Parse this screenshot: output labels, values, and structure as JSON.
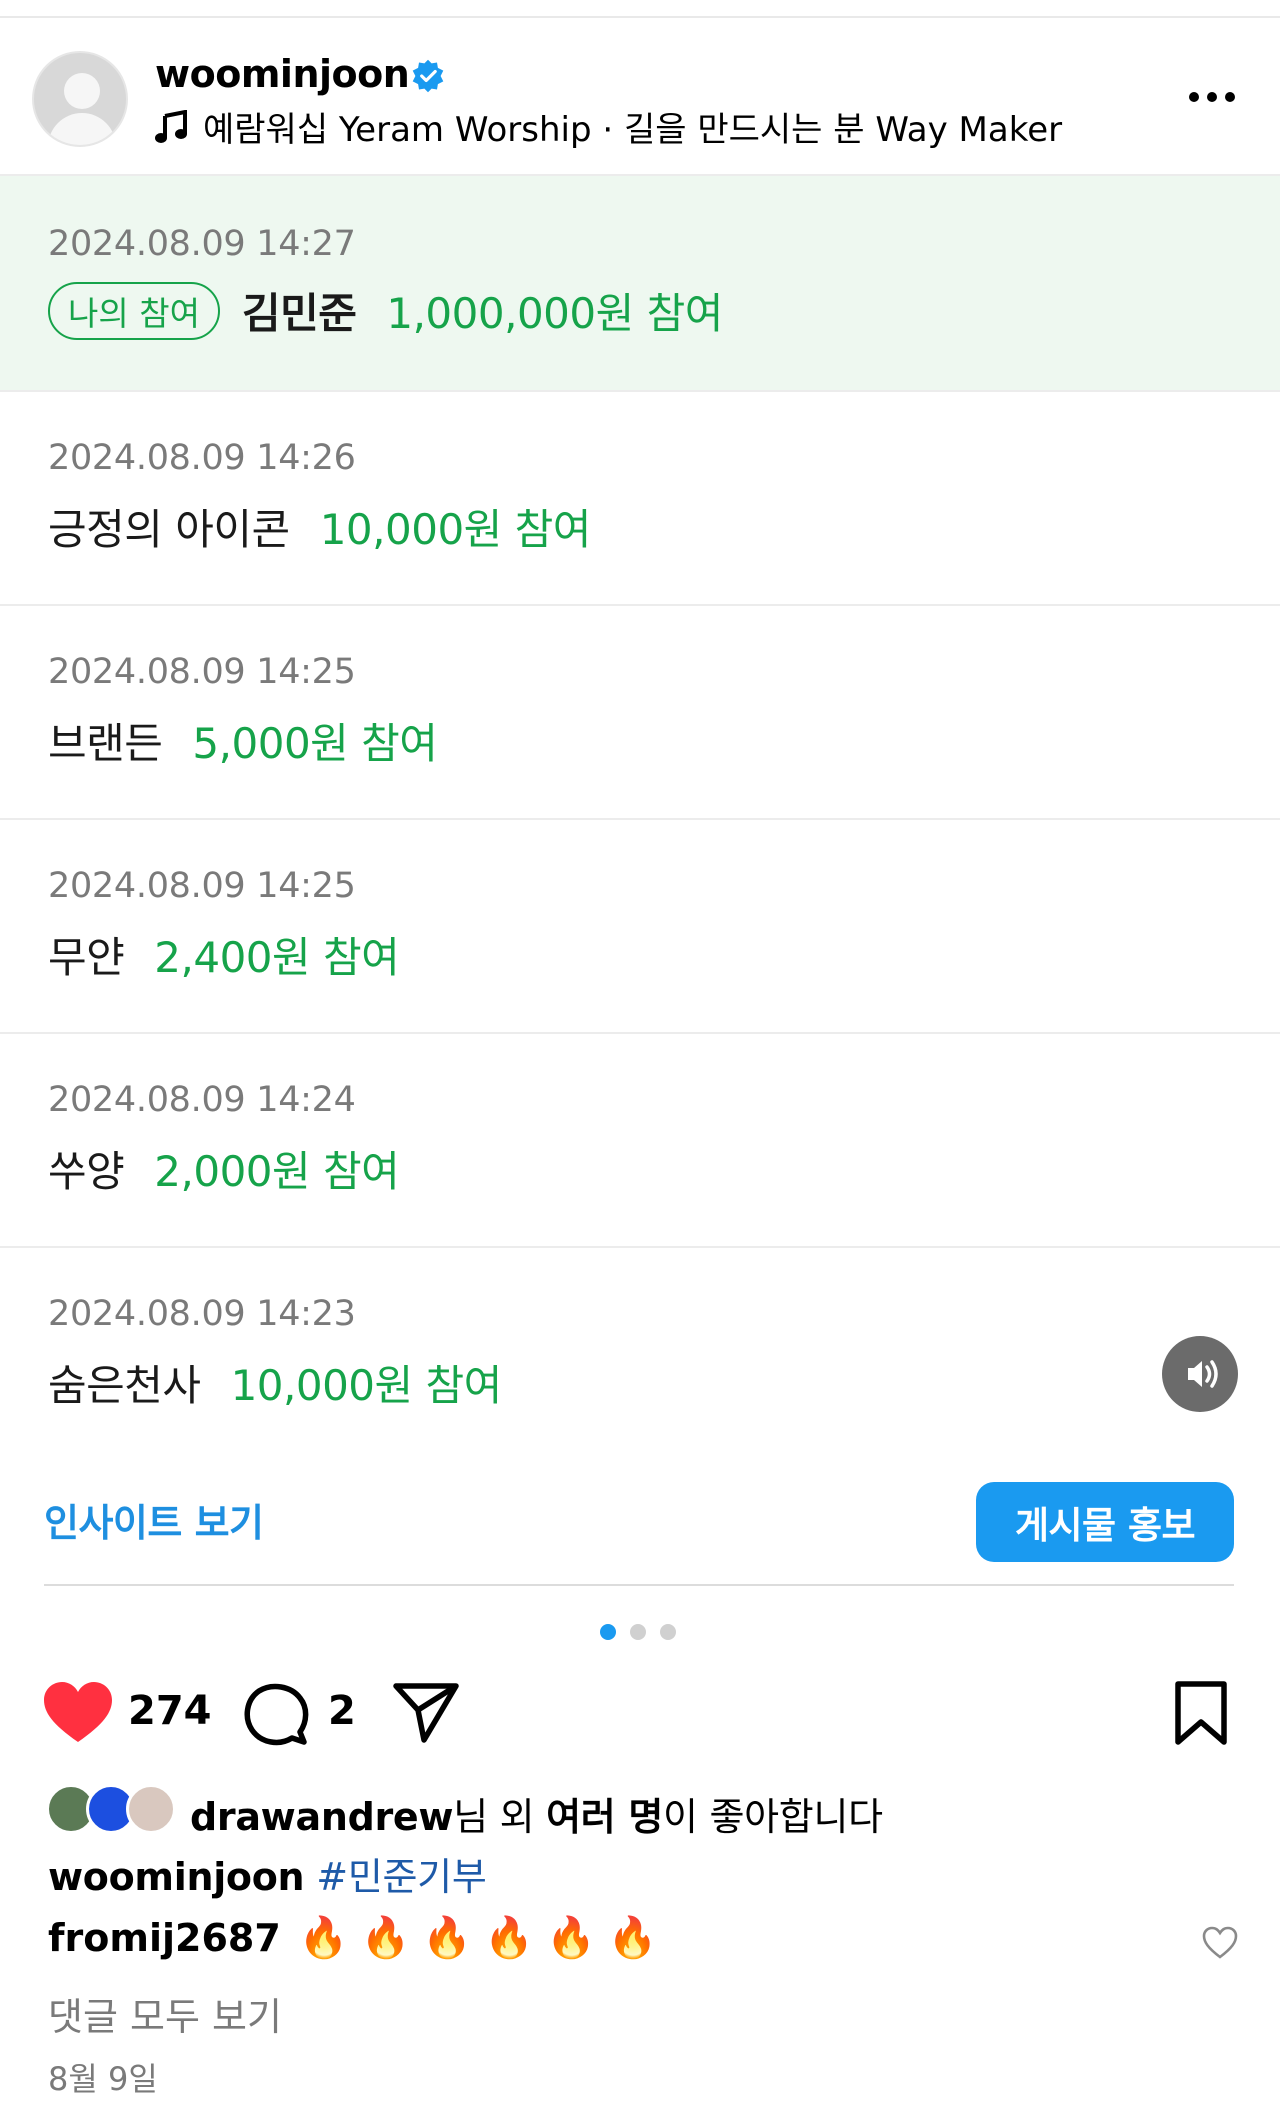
{
  "header": {
    "username": "woominjoon",
    "music": "예람워십 Yeram Worship · 길을 만드시는 분 Way Maker"
  },
  "donations": [
    {
      "time": "2024.08.09 14:27",
      "badge": "나의 참여",
      "name": "김민준",
      "amount": "1,000,000원 참여"
    },
    {
      "time": "2024.08.09 14:26",
      "name": "긍정의 아이콘",
      "amount": "10,000원 참여"
    },
    {
      "time": "2024.08.09 14:25",
      "name": "브랜든",
      "amount": "5,000원 참여"
    },
    {
      "time": "2024.08.09 14:25",
      "name": "무얀",
      "amount": "2,400원 참여"
    },
    {
      "time": "2024.08.09 14:24",
      "name": "쑤양",
      "amount": "2,000원 참여"
    },
    {
      "time": "2024.08.09 14:23",
      "name": "숨은천사",
      "amount": "10,000원 참여"
    }
  ],
  "actions": {
    "insights_label": "인사이트 보기",
    "promote_label": "게시물 홍보",
    "like_count": "274",
    "comment_count": "2"
  },
  "likes": {
    "user": "drawandrew",
    "mid": "님 외 ",
    "bold": "여러 명",
    "tail": "이 좋아합니다"
  },
  "caption": {
    "user": "woominjoon",
    "hashtag": "#민준기부"
  },
  "comment": {
    "user": "fromij2687",
    "emoji": "🔥"
  },
  "view_all": "댓글 모두 보기",
  "date": "8월 9일",
  "colors": {
    "accent_green": "#16a34a",
    "blue": "#1a9af0",
    "like_red": "#ff3040"
  }
}
